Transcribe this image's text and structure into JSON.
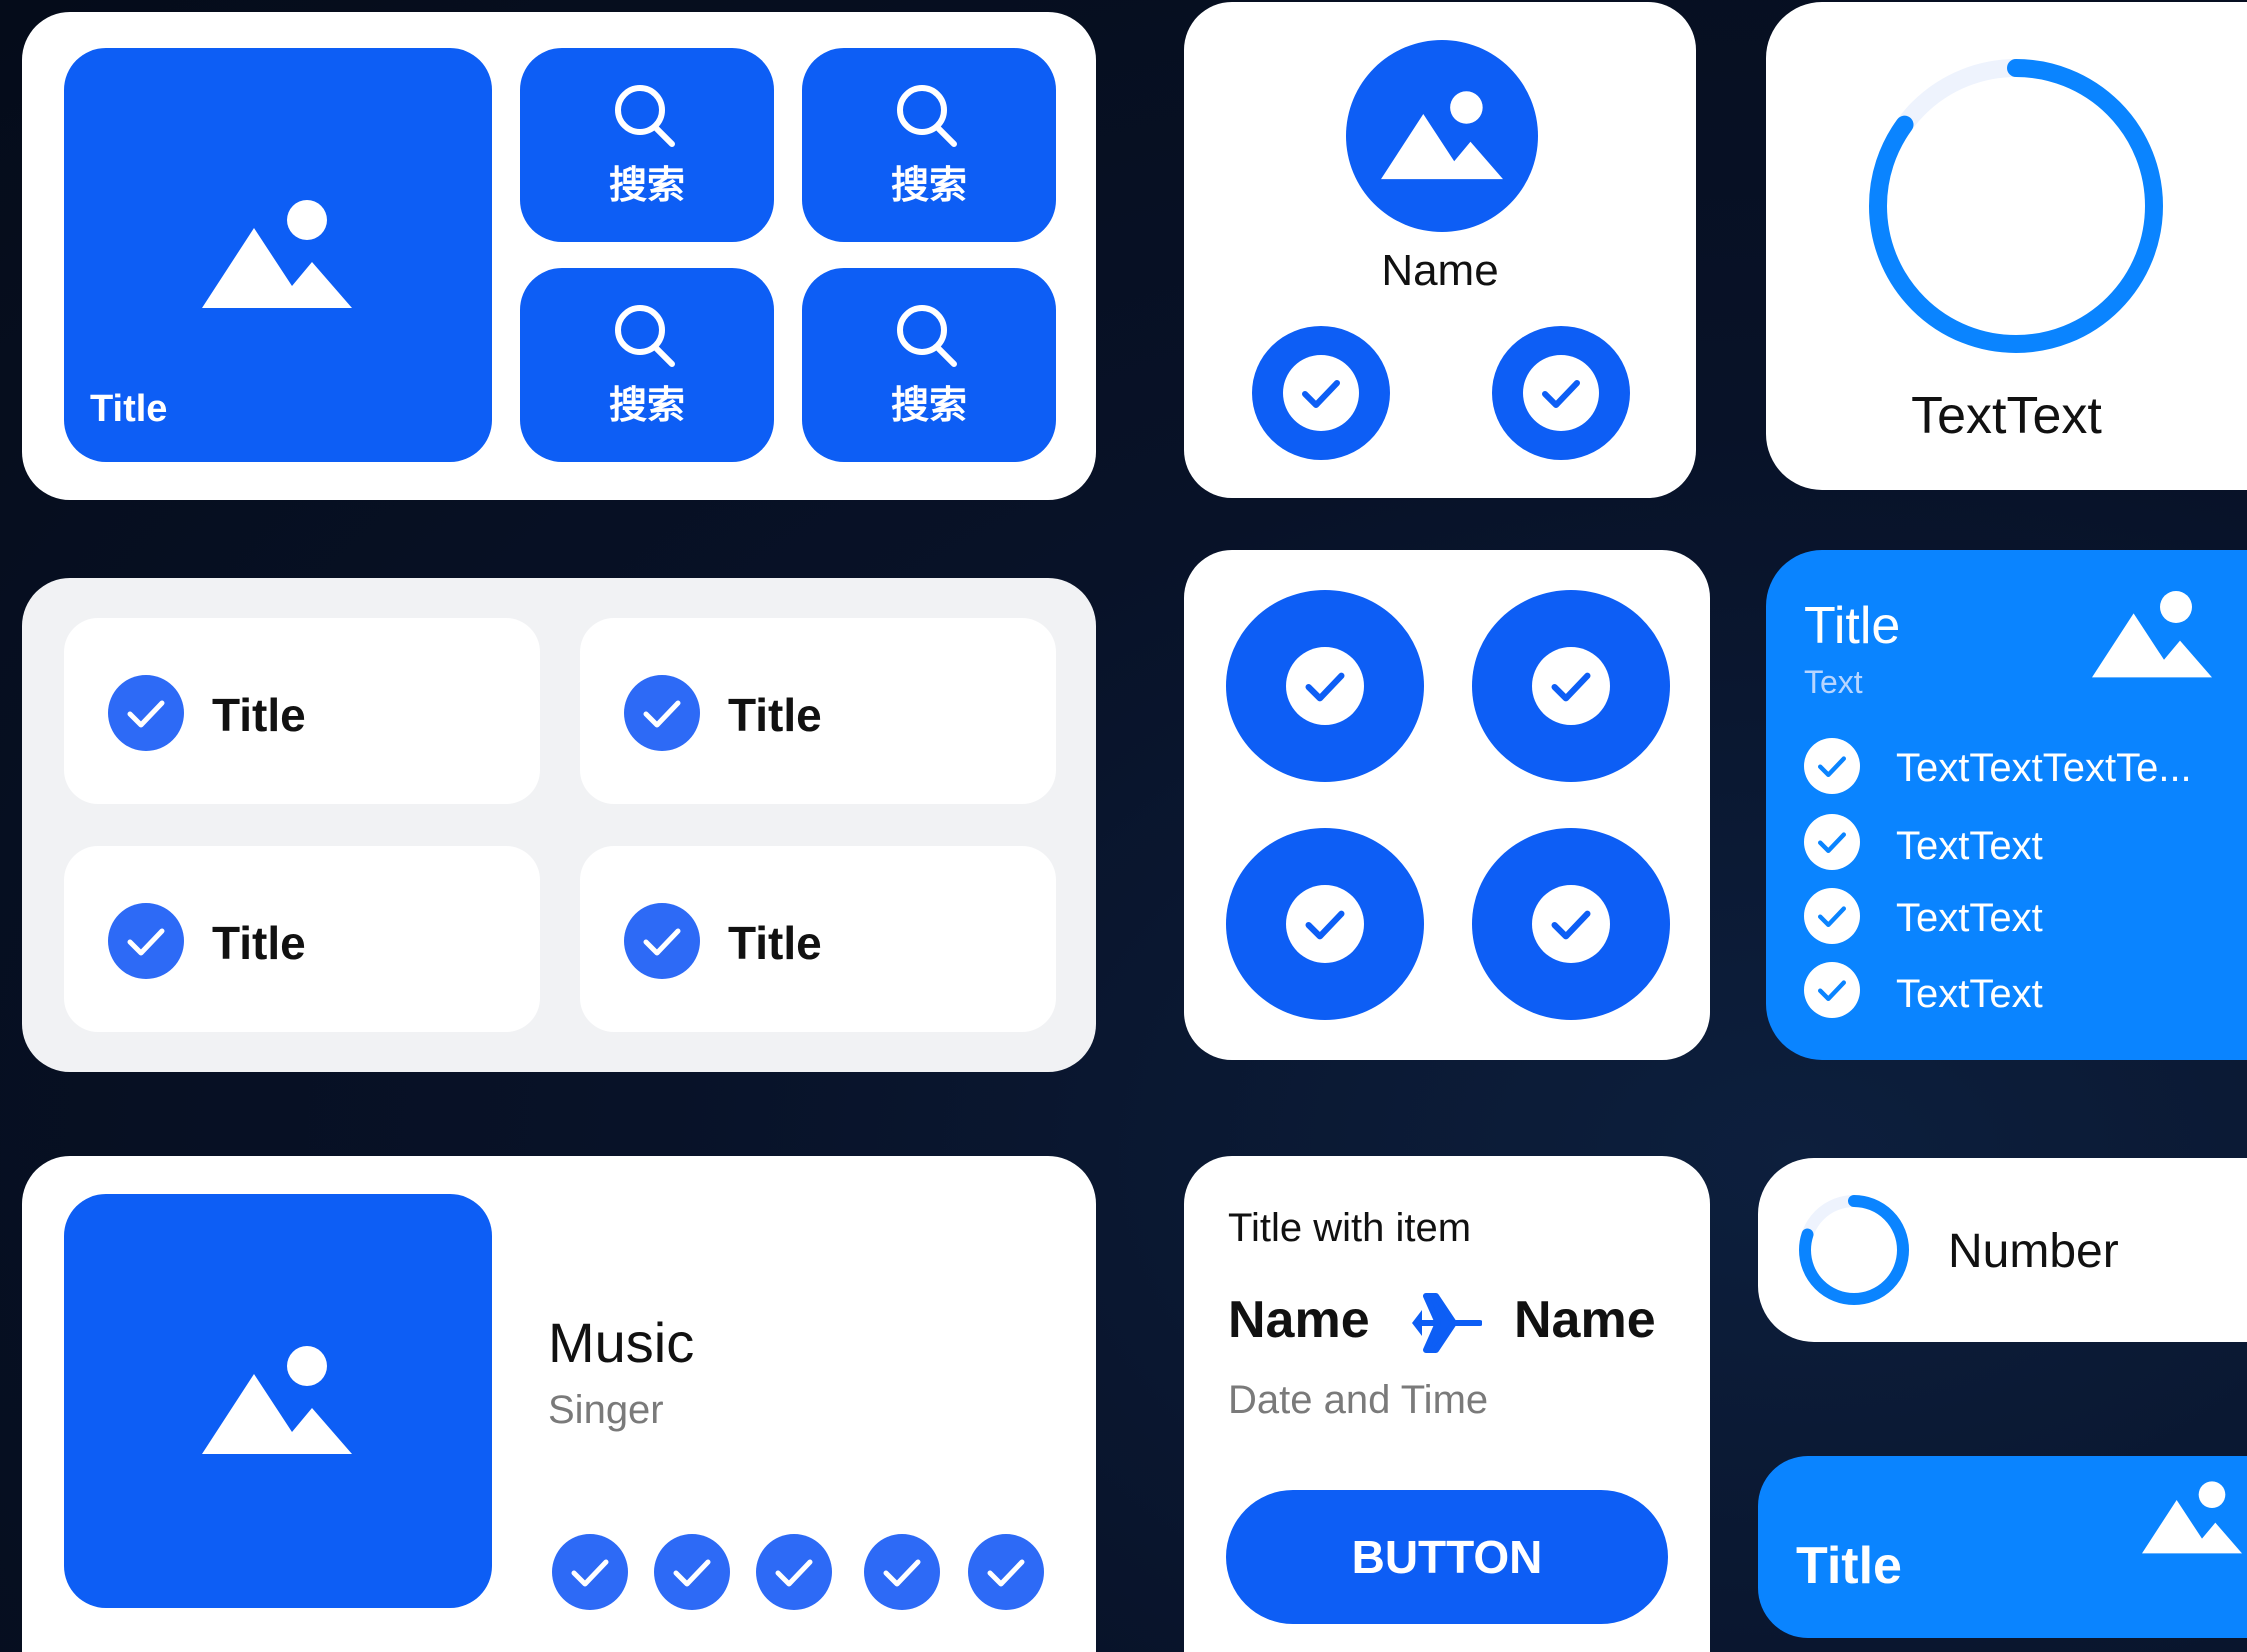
{
  "colors": {
    "primary": "#0d5ef5",
    "accent": "#0a84ff",
    "card": "#ffffff",
    "card_gray": "#f1f2f4",
    "text": "#111111",
    "muted": "#7a7a7a"
  },
  "quick_search": {
    "photo_title": "Title",
    "buttons": [
      {
        "label": "搜索",
        "icon": "search-icon"
      },
      {
        "label": "搜索",
        "icon": "search-icon"
      },
      {
        "label": "搜索",
        "icon": "search-icon"
      },
      {
        "label": "搜索",
        "icon": "search-icon"
      }
    ]
  },
  "profile_card": {
    "name": "Name",
    "actions": [
      "check-icon",
      "check-icon"
    ]
  },
  "progress_ring": {
    "label": "TextText",
    "progress": 0.85
  },
  "check_grid": {
    "items": [
      {
        "label": "Title"
      },
      {
        "label": "Title"
      },
      {
        "label": "Title"
      },
      {
        "label": "Title"
      }
    ]
  },
  "circle_grid": {
    "items": [
      "check-icon",
      "check-icon",
      "check-icon",
      "check-icon"
    ]
  },
  "checklist_card": {
    "title": "Title",
    "subtitle": "Text",
    "items": [
      "TextTextTextTe...",
      "TextText",
      "TextText",
      "TextText"
    ]
  },
  "music_card": {
    "title": "Music",
    "artist": "Singer",
    "controls": [
      "check-icon",
      "check-icon",
      "check-icon",
      "check-icon",
      "check-icon"
    ]
  },
  "flight_card": {
    "title": "Title with item",
    "from": "Name",
    "to": "Name",
    "datetime": "Date and Time",
    "button": "BUTTON"
  },
  "number_card": {
    "label": "Number",
    "progress": 0.8
  },
  "title_card": {
    "title": "Title"
  }
}
